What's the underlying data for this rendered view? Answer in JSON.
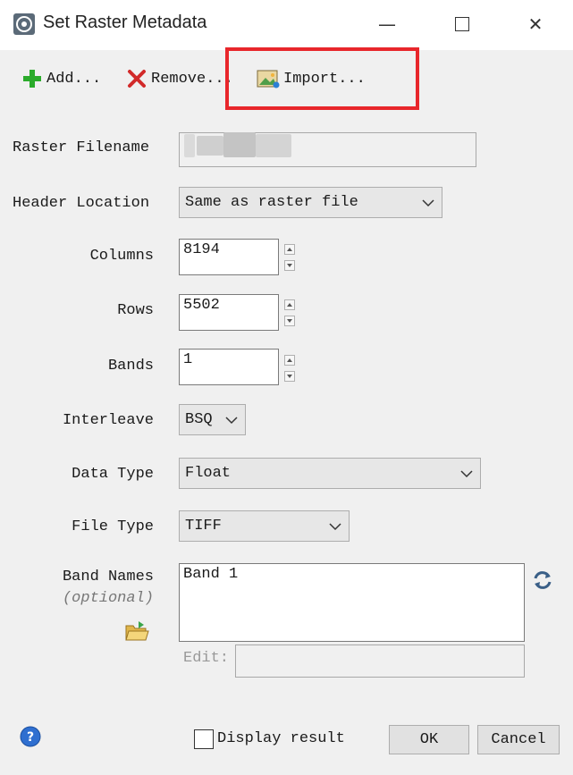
{
  "window": {
    "title": "Set Raster Metadata"
  },
  "toolbar": {
    "add_label": "Add...",
    "remove_label": "Remove...",
    "import_label": "Import..."
  },
  "form": {
    "raster_filename_label": "Raster Filename",
    "header_location_label": "Header Location",
    "header_location_value": "Same as raster file",
    "columns_label": "Columns",
    "columns_value": "8194",
    "rows_label": "Rows",
    "rows_value": "5502",
    "bands_label": "Bands",
    "bands_value": "1",
    "interleave_label": "Interleave",
    "interleave_value": "BSQ",
    "data_type_label": "Data Type",
    "data_type_value": "Float",
    "file_type_label": "File Type",
    "file_type_value": "TIFF",
    "band_names_label": "Band Names",
    "band_names_optional": "(optional)",
    "band_names_value": "Band 1",
    "edit_label": "Edit:"
  },
  "footer": {
    "display_result_label": "Display result",
    "ok_label": "OK",
    "cancel_label": "Cancel"
  }
}
